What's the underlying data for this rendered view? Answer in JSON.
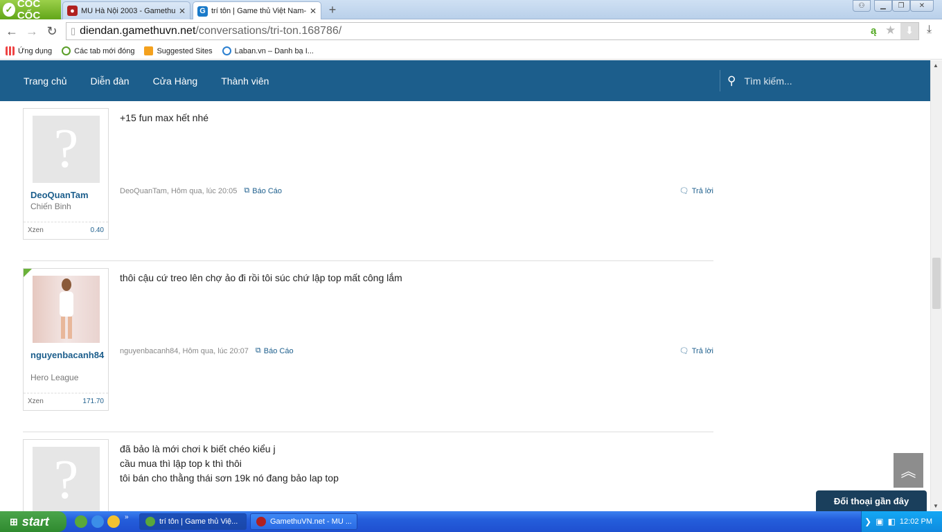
{
  "browser": {
    "brand": "CỐC CỐC",
    "tabs": [
      {
        "title": "MU Hà Nội 2003 - GamethuVN"
      },
      {
        "title": "trí tôn | Game thủ Việt Nam-"
      }
    ],
    "url_host": "diendan.gamethuvn.net",
    "url_path": "/conversations/tri-ton.168786/",
    "bookmarks": [
      {
        "label": "Ứng dụng"
      },
      {
        "label": "Các tab mới đóng"
      },
      {
        "label": "Suggested Sites"
      },
      {
        "label": "Laban.vn – Danh bạ I..."
      }
    ]
  },
  "site": {
    "nav": [
      "Trang chủ",
      "Diễn đàn",
      "Cửa Hàng",
      "Thành viên"
    ],
    "search_placeholder": "Tìm kiếm..."
  },
  "posts": [
    {
      "username": "DeoQuanTam",
      "user_title": "Chiến Binh",
      "xzen_label": "Xzen",
      "xzen_value": "0.40",
      "lines": [
        "+15 fun max hết nhé"
      ],
      "meta": "DeoQuanTam, Hôm qua, lúc 20:05",
      "report": "Báo Cáo",
      "reply": "Trả lời"
    },
    {
      "username": "nguyenbacanh84",
      "user_title": "Hero League",
      "xzen_label": "Xzen",
      "xzen_value": "171.70",
      "lines": [
        "thôi cậu cứ treo lên chợ ảo đi rồi tôi súc chứ lập top mất công lắm"
      ],
      "meta": "nguyenbacanh84, Hôm qua, lúc 20:07",
      "report": "Báo Cáo",
      "reply": "Trả lời"
    },
    {
      "lines": [
        "đã bảo là mới chơi k biết chéo kiểu j",
        "cầu mua thì lập top k thì thôi",
        "tôi bán cho thằng thái sơn 19k nó đang bảo lap top"
      ]
    }
  ],
  "recent_conversations": "Đối thoại gần đây",
  "taskbar": {
    "start": "start",
    "tasks": [
      "trí tôn | Game thủ Việ...",
      "GamethuVN.net - MU ..."
    ],
    "clock": "12:02 PM"
  },
  "colors": {
    "site_nav": "#1c5e8c",
    "link": "#1c5e8c"
  }
}
